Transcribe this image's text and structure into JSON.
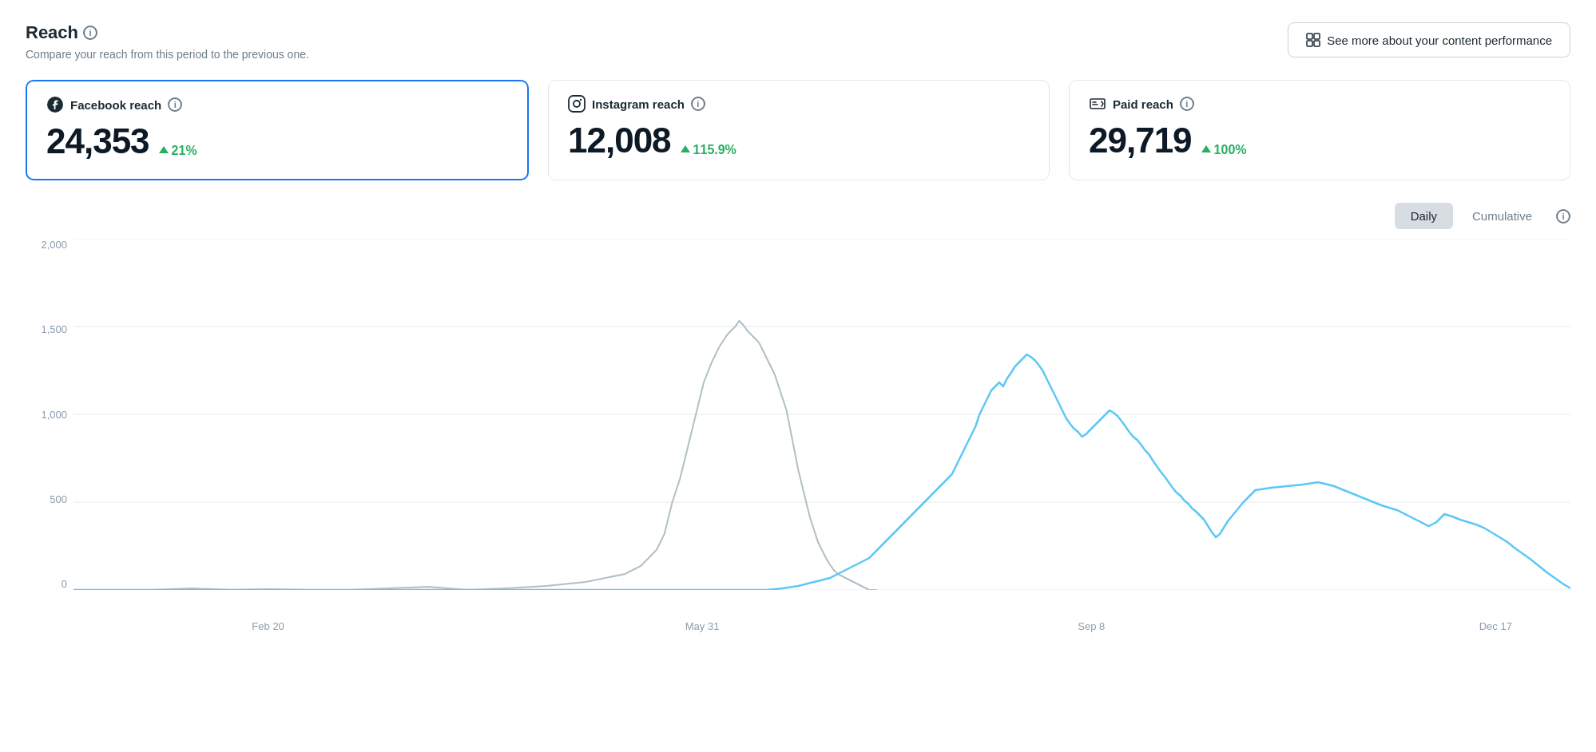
{
  "header": {
    "title": "Reach",
    "subtitle": "Compare your reach from this period to the previous one.",
    "see_more_label": "See more about your content performance"
  },
  "metrics": [
    {
      "id": "facebook",
      "label": "Facebook reach",
      "value": "24,353",
      "change": "21%",
      "selected": true
    },
    {
      "id": "instagram",
      "label": "Instagram reach",
      "value": "12,008",
      "change": "115.9%",
      "selected": false
    },
    {
      "id": "paid",
      "label": "Paid reach",
      "value": "29,719",
      "change": "100%",
      "selected": false
    }
  ],
  "chart": {
    "toggle": {
      "daily": "Daily",
      "cumulative": "Cumulative"
    },
    "active_toggle": "Daily",
    "y_labels": [
      "2,000",
      "1,500",
      "1,000",
      "500",
      "0"
    ],
    "x_labels": [
      "Feb 20",
      "May 31",
      "Sep 8",
      "Dec 17"
    ]
  },
  "icons": {
    "info": "i",
    "table": "⊞"
  }
}
